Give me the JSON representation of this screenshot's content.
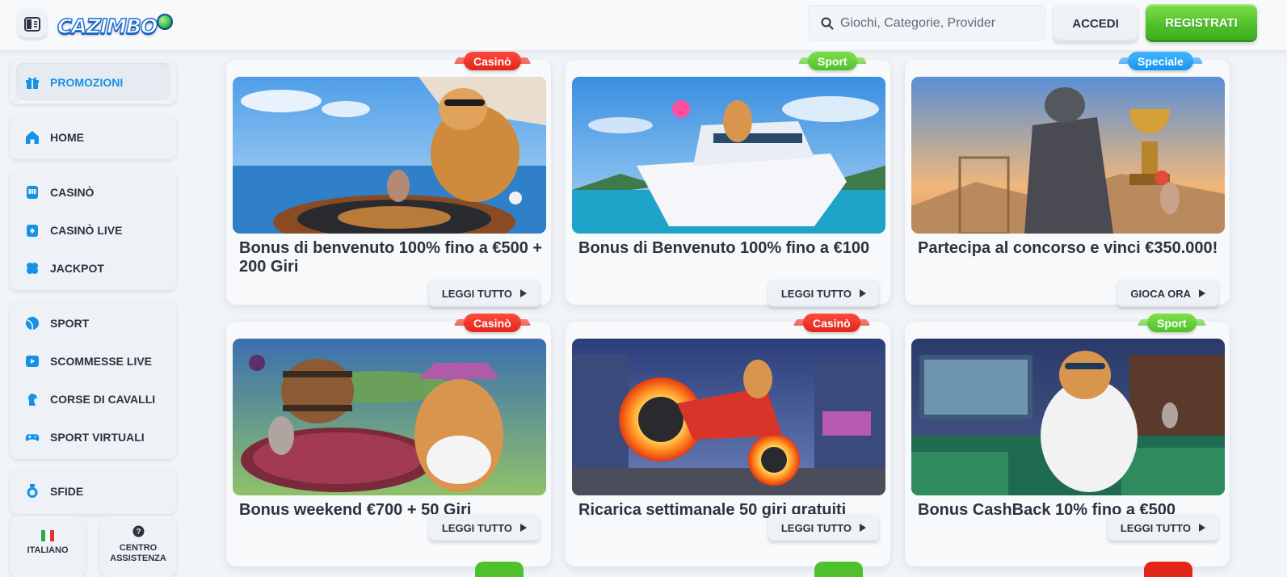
{
  "header": {
    "logo_text": "CAZIMBO",
    "search_placeholder": "Giochi, Categorie, Provider",
    "login_label": "ACCEDI",
    "register_label": "REGISTRATI"
  },
  "sidebar": {
    "groups": [
      {
        "items": [
          {
            "label": "PROMOZIONI",
            "icon": "gift-icon",
            "active": true
          }
        ]
      },
      {
        "items": [
          {
            "label": "HOME",
            "icon": "home-icon"
          }
        ]
      },
      {
        "items": [
          {
            "label": "CASINÒ",
            "icon": "slot-machine-icon"
          },
          {
            "label": "CASINÒ LIVE",
            "icon": "live-casino-icon"
          },
          {
            "label": "JACKPOT",
            "icon": "clover-icon"
          }
        ]
      },
      {
        "items": [
          {
            "label": "SPORT",
            "icon": "ball-icon"
          },
          {
            "label": "SCOMMESSE LIVE",
            "icon": "play-icon"
          },
          {
            "label": "CORSE DI CAVALLI",
            "icon": "horse-icon"
          },
          {
            "label": "SPORT VIRTUALI",
            "icon": "gamepad-icon"
          }
        ]
      },
      {
        "items": [
          {
            "label": "SFIDE",
            "icon": "medal-icon"
          }
        ]
      }
    ],
    "language_label": "ITALIANO",
    "help_label_1": "CENTRO",
    "help_label_2": "ASSISTENZA"
  },
  "promotions": [
    {
      "badge": "Casinò",
      "title": "Bonus di benvenuto 100% fino a €500 + 200 Giri",
      "button": "LEGGI TUTTO"
    },
    {
      "badge": "Sport",
      "title": "Bonus di Benvenuto 100% fino a €100",
      "button": "LEGGI TUTTO"
    },
    {
      "badge": "Speciale",
      "title": "Partecipa al concorso e vinci €350.000!",
      "button": "GIOCA ORA"
    },
    {
      "badge": "Casinò",
      "title": "Bonus weekend €700 + 50 Giri",
      "button": "LEGGI TUTTO"
    },
    {
      "badge": "Casinò",
      "title": "Ricarica settimanale 50 giri gratuiti",
      "button": "LEGGI TUTTO"
    },
    {
      "badge": "Sport",
      "title": "Bonus CashBack 10% fino a €500",
      "button": "LEGGI TUTTO"
    }
  ],
  "colors": {
    "accent_blue": "#1592e8",
    "register_green": "#4fc12b",
    "badge_red": "#e3261a",
    "badge_green": "#4fc12b",
    "badge_blue": "#1893ee"
  }
}
